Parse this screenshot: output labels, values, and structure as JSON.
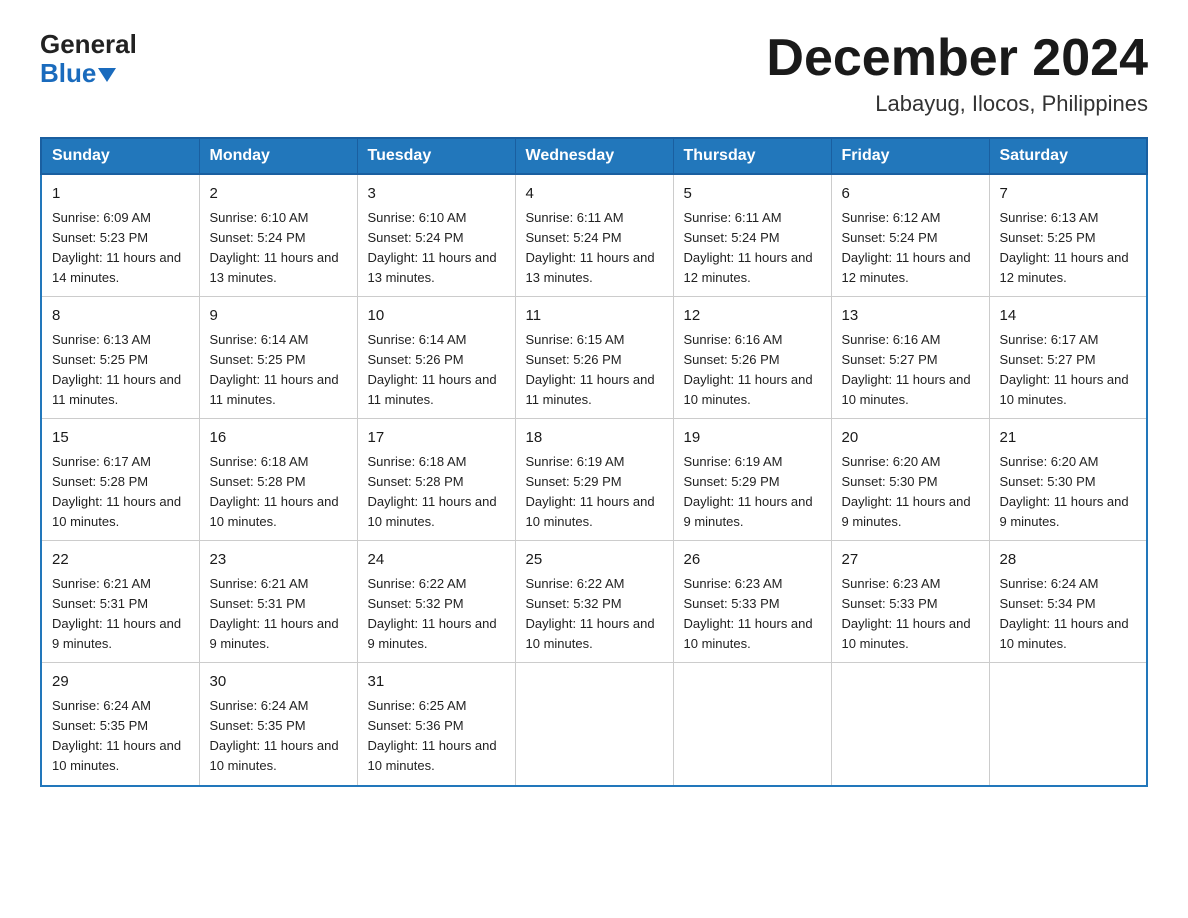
{
  "logo": {
    "line1": "General",
    "line2": "Blue"
  },
  "title": "December 2024",
  "location": "Labayug, Ilocos, Philippines",
  "header_days": [
    "Sunday",
    "Monday",
    "Tuesday",
    "Wednesday",
    "Thursday",
    "Friday",
    "Saturday"
  ],
  "weeks": [
    [
      {
        "date": "1",
        "sunrise": "6:09 AM",
        "sunset": "5:23 PM",
        "daylight": "11 hours and 14 minutes."
      },
      {
        "date": "2",
        "sunrise": "6:10 AM",
        "sunset": "5:24 PM",
        "daylight": "11 hours and 13 minutes."
      },
      {
        "date": "3",
        "sunrise": "6:10 AM",
        "sunset": "5:24 PM",
        "daylight": "11 hours and 13 minutes."
      },
      {
        "date": "4",
        "sunrise": "6:11 AM",
        "sunset": "5:24 PM",
        "daylight": "11 hours and 13 minutes."
      },
      {
        "date": "5",
        "sunrise": "6:11 AM",
        "sunset": "5:24 PM",
        "daylight": "11 hours and 12 minutes."
      },
      {
        "date": "6",
        "sunrise": "6:12 AM",
        "sunset": "5:24 PM",
        "daylight": "11 hours and 12 minutes."
      },
      {
        "date": "7",
        "sunrise": "6:13 AM",
        "sunset": "5:25 PM",
        "daylight": "11 hours and 12 minutes."
      }
    ],
    [
      {
        "date": "8",
        "sunrise": "6:13 AM",
        "sunset": "5:25 PM",
        "daylight": "11 hours and 11 minutes."
      },
      {
        "date": "9",
        "sunrise": "6:14 AM",
        "sunset": "5:25 PM",
        "daylight": "11 hours and 11 minutes."
      },
      {
        "date": "10",
        "sunrise": "6:14 AM",
        "sunset": "5:26 PM",
        "daylight": "11 hours and 11 minutes."
      },
      {
        "date": "11",
        "sunrise": "6:15 AM",
        "sunset": "5:26 PM",
        "daylight": "11 hours and 11 minutes."
      },
      {
        "date": "12",
        "sunrise": "6:16 AM",
        "sunset": "5:26 PM",
        "daylight": "11 hours and 10 minutes."
      },
      {
        "date": "13",
        "sunrise": "6:16 AM",
        "sunset": "5:27 PM",
        "daylight": "11 hours and 10 minutes."
      },
      {
        "date": "14",
        "sunrise": "6:17 AM",
        "sunset": "5:27 PM",
        "daylight": "11 hours and 10 minutes."
      }
    ],
    [
      {
        "date": "15",
        "sunrise": "6:17 AM",
        "sunset": "5:28 PM",
        "daylight": "11 hours and 10 minutes."
      },
      {
        "date": "16",
        "sunrise": "6:18 AM",
        "sunset": "5:28 PM",
        "daylight": "11 hours and 10 minutes."
      },
      {
        "date": "17",
        "sunrise": "6:18 AM",
        "sunset": "5:28 PM",
        "daylight": "11 hours and 10 minutes."
      },
      {
        "date": "18",
        "sunrise": "6:19 AM",
        "sunset": "5:29 PM",
        "daylight": "11 hours and 10 minutes."
      },
      {
        "date": "19",
        "sunrise": "6:19 AM",
        "sunset": "5:29 PM",
        "daylight": "11 hours and 9 minutes."
      },
      {
        "date": "20",
        "sunrise": "6:20 AM",
        "sunset": "5:30 PM",
        "daylight": "11 hours and 9 minutes."
      },
      {
        "date": "21",
        "sunrise": "6:20 AM",
        "sunset": "5:30 PM",
        "daylight": "11 hours and 9 minutes."
      }
    ],
    [
      {
        "date": "22",
        "sunrise": "6:21 AM",
        "sunset": "5:31 PM",
        "daylight": "11 hours and 9 minutes."
      },
      {
        "date": "23",
        "sunrise": "6:21 AM",
        "sunset": "5:31 PM",
        "daylight": "11 hours and 9 minutes."
      },
      {
        "date": "24",
        "sunrise": "6:22 AM",
        "sunset": "5:32 PM",
        "daylight": "11 hours and 9 minutes."
      },
      {
        "date": "25",
        "sunrise": "6:22 AM",
        "sunset": "5:32 PM",
        "daylight": "11 hours and 10 minutes."
      },
      {
        "date": "26",
        "sunrise": "6:23 AM",
        "sunset": "5:33 PM",
        "daylight": "11 hours and 10 minutes."
      },
      {
        "date": "27",
        "sunrise": "6:23 AM",
        "sunset": "5:33 PM",
        "daylight": "11 hours and 10 minutes."
      },
      {
        "date": "28",
        "sunrise": "6:24 AM",
        "sunset": "5:34 PM",
        "daylight": "11 hours and 10 minutes."
      }
    ],
    [
      {
        "date": "29",
        "sunrise": "6:24 AM",
        "sunset": "5:35 PM",
        "daylight": "11 hours and 10 minutes."
      },
      {
        "date": "30",
        "sunrise": "6:24 AM",
        "sunset": "5:35 PM",
        "daylight": "11 hours and 10 minutes."
      },
      {
        "date": "31",
        "sunrise": "6:25 AM",
        "sunset": "5:36 PM",
        "daylight": "11 hours and 10 minutes."
      },
      null,
      null,
      null,
      null
    ]
  ]
}
